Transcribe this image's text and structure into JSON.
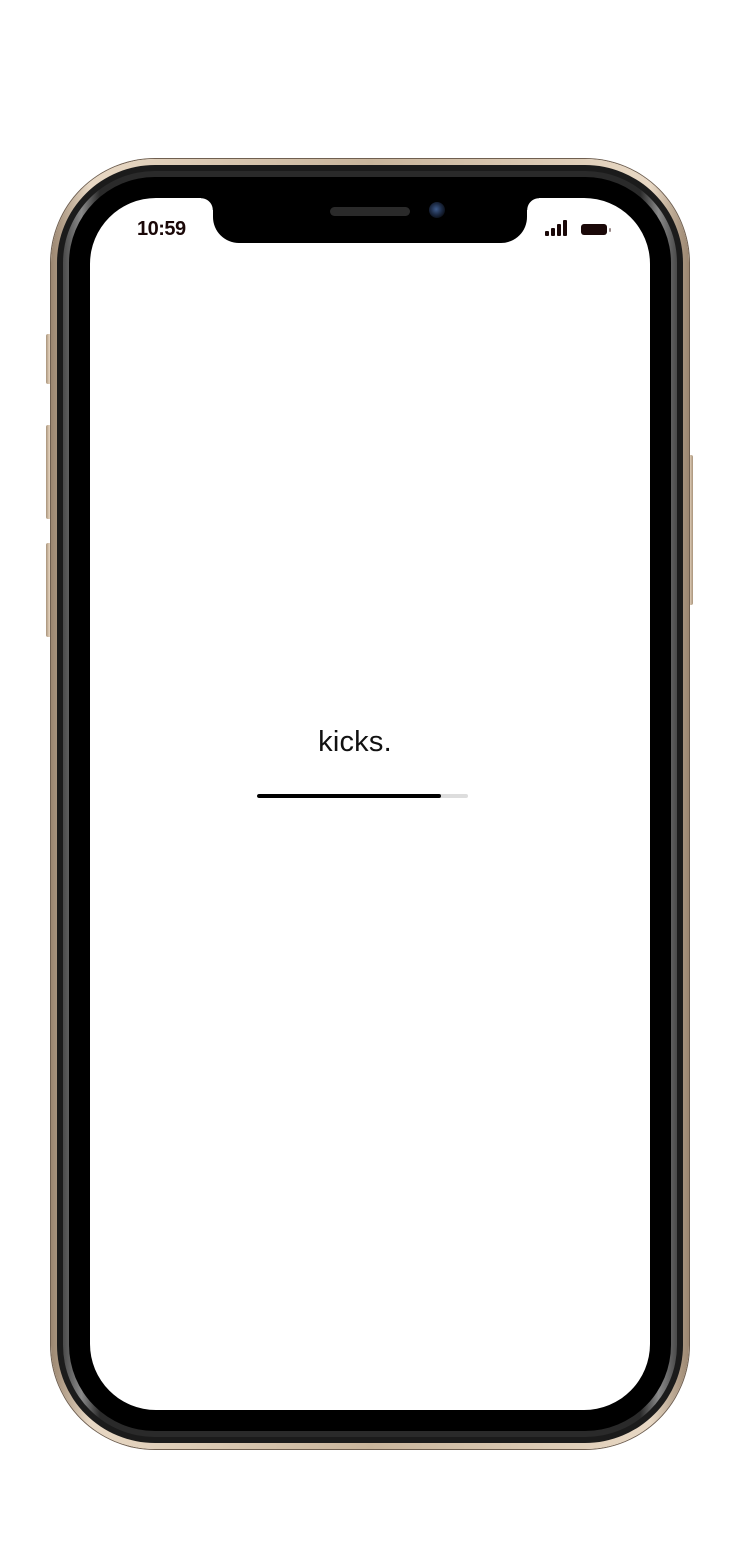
{
  "status_bar": {
    "time": "10:59",
    "signal_icon": "cellular-signal-icon",
    "battery_icon": "battery-icon"
  },
  "splash": {
    "brand_text": "kicks.",
    "loading_progress": 0.87
  },
  "colors": {
    "status_text": "#1a0808",
    "progress_fill": "#000000",
    "progress_track": "#dddddd",
    "frame_gold": "#c9b59c"
  }
}
